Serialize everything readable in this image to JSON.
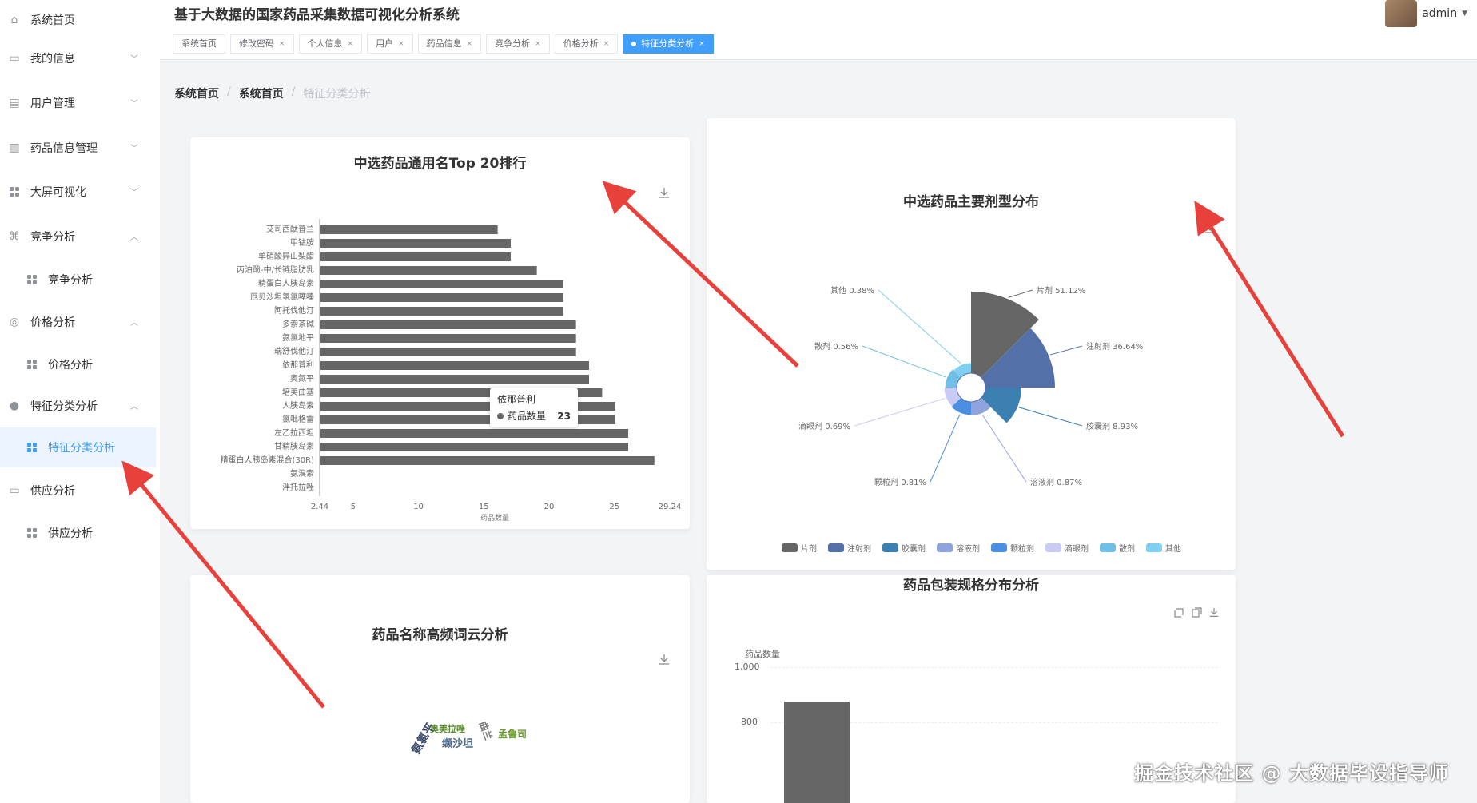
{
  "app": {
    "title": "基于大数据的国家药品采集数据可视化分析系统",
    "user": "admin"
  },
  "sidebar": {
    "items": [
      {
        "label": "系统首页",
        "type": "top"
      },
      {
        "label": "我的信息",
        "type": "group"
      },
      {
        "label": "用户管理",
        "type": "group"
      },
      {
        "label": "药品信息管理",
        "type": "group"
      },
      {
        "label": "大屏可视化",
        "type": "group"
      },
      {
        "label": "竞争分析",
        "type": "group-open"
      },
      {
        "label": "竞争分析",
        "type": "sub"
      },
      {
        "label": "价格分析",
        "type": "group-open"
      },
      {
        "label": "价格分析",
        "type": "sub"
      },
      {
        "label": "特征分类分析",
        "type": "group-open"
      },
      {
        "label": "特征分类分析",
        "type": "sub-active"
      },
      {
        "label": "供应分析",
        "type": "group"
      },
      {
        "label": "供应分析",
        "type": "sub"
      }
    ]
  },
  "tabs": [
    "系统首页",
    "修改密码",
    "个人信息",
    "用户",
    "药品信息",
    "竞争分析",
    "价格分析",
    "特征分类分析"
  ],
  "active_tab": "特征分类分析",
  "breadcrumb": [
    "系统首页",
    "系统首页",
    "特征分类分析"
  ],
  "cards": {
    "top20_title": "中选药品通用名Top 20排行",
    "dosage_title": "中选药品主要剂型分布",
    "wordcloud_title": "药品名称高频词云分析",
    "package_title": "药品包装规格分布分析"
  },
  "tooltip": {
    "name": "依那普利",
    "series": "药品数量",
    "value": "23"
  },
  "watermark": "掘金技术社区 @ 大数据毕设指导师",
  "colors": {
    "accent": "#409eff",
    "bar": "#666666",
    "arrow": "#e8413c"
  },
  "chart_data": [
    {
      "type": "bar",
      "orientation": "horizontal",
      "title": "中选药品通用名Top 20排行",
      "xlabel": "药品数量",
      "xlim": [
        2.44,
        29.24
      ],
      "xticks": [
        "2.44",
        "5",
        "10",
        "15",
        "20",
        "25",
        "29.24"
      ],
      "categories": [
        "艾司西酞普兰",
        "甲钴胺",
        "单硝酸异山梨酯",
        "丙泊酚-中/长链脂肪乳",
        "精蛋白人胰岛素",
        "厄贝沙坦氢氯噻嗪",
        "阿托伐他汀",
        "多索茶碱",
        "氨氯地平",
        "瑞舒伐他汀",
        "依那普利",
        "奥氮平",
        "培美曲塞",
        "人胰岛素",
        "氯吡格雷",
        "左乙拉西坦",
        "甘精胰岛素",
        "精蛋白人胰岛素混合(30R)",
        "氨溴索",
        "泮托拉唑"
      ],
      "values": [
        16,
        17,
        17,
        19,
        21,
        21,
        21,
        22,
        22,
        22,
        23,
        23,
        24,
        25,
        25,
        26,
        26,
        28,
        0,
        0
      ]
    },
    {
      "type": "pie",
      "variant": "rose",
      "title": "中选药品主要剂型分布",
      "labels": [
        "片剂",
        "注射剂",
        "胶囊剂",
        "溶液剂",
        "颗粒剂",
        "滴眼剂",
        "散剂",
        "其他"
      ],
      "values": [
        51.12,
        36.64,
        8.93,
        0.87,
        0.81,
        0.69,
        0.56,
        0.38
      ],
      "label_text": [
        "片剂 51.12%",
        "注射剂 36.64%",
        "胶囊剂 8.93%",
        "溶液剂 0.87%",
        "颗粒剂 0.81%",
        "滴眼剂 0.69%",
        "散剂 0.56%",
        "其他 0.38%"
      ],
      "colors": [
        "#666666",
        "#5470a8",
        "#3c7fb1",
        "#8fa3dc",
        "#4a8fe0",
        "#c9cbf5",
        "#6fbfe6",
        "#7fd0f0"
      ]
    },
    {
      "type": "bar",
      "title": "药品包装规格分布分析",
      "ylabel": "药品数量",
      "yticks": [
        "800",
        "1,000"
      ]
    }
  ]
}
